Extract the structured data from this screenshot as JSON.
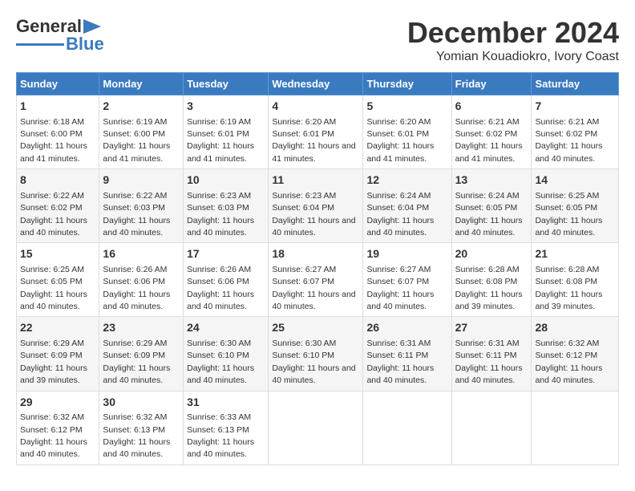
{
  "header": {
    "logo_general": "General",
    "logo_blue": "Blue",
    "title": "December 2024",
    "subtitle": "Yomian Kouadiokro, Ivory Coast"
  },
  "calendar": {
    "days_of_week": [
      "Sunday",
      "Monday",
      "Tuesday",
      "Wednesday",
      "Thursday",
      "Friday",
      "Saturday"
    ],
    "weeks": [
      [
        {
          "day": "1",
          "sunrise": "Sunrise: 6:18 AM",
          "sunset": "Sunset: 6:00 PM",
          "daylight": "Daylight: 11 hours and 41 minutes."
        },
        {
          "day": "2",
          "sunrise": "Sunrise: 6:19 AM",
          "sunset": "Sunset: 6:00 PM",
          "daylight": "Daylight: 11 hours and 41 minutes."
        },
        {
          "day": "3",
          "sunrise": "Sunrise: 6:19 AM",
          "sunset": "Sunset: 6:01 PM",
          "daylight": "Daylight: 11 hours and 41 minutes."
        },
        {
          "day": "4",
          "sunrise": "Sunrise: 6:20 AM",
          "sunset": "Sunset: 6:01 PM",
          "daylight": "Daylight: 11 hours and 41 minutes."
        },
        {
          "day": "5",
          "sunrise": "Sunrise: 6:20 AM",
          "sunset": "Sunset: 6:01 PM",
          "daylight": "Daylight: 11 hours and 41 minutes."
        },
        {
          "day": "6",
          "sunrise": "Sunrise: 6:21 AM",
          "sunset": "Sunset: 6:02 PM",
          "daylight": "Daylight: 11 hours and 41 minutes."
        },
        {
          "day": "7",
          "sunrise": "Sunrise: 6:21 AM",
          "sunset": "Sunset: 6:02 PM",
          "daylight": "Daylight: 11 hours and 40 minutes."
        }
      ],
      [
        {
          "day": "8",
          "sunrise": "Sunrise: 6:22 AM",
          "sunset": "Sunset: 6:02 PM",
          "daylight": "Daylight: 11 hours and 40 minutes."
        },
        {
          "day": "9",
          "sunrise": "Sunrise: 6:22 AM",
          "sunset": "Sunset: 6:03 PM",
          "daylight": "Daylight: 11 hours and 40 minutes."
        },
        {
          "day": "10",
          "sunrise": "Sunrise: 6:23 AM",
          "sunset": "Sunset: 6:03 PM",
          "daylight": "Daylight: 11 hours and 40 minutes."
        },
        {
          "day": "11",
          "sunrise": "Sunrise: 6:23 AM",
          "sunset": "Sunset: 6:04 PM",
          "daylight": "Daylight: 11 hours and 40 minutes."
        },
        {
          "day": "12",
          "sunrise": "Sunrise: 6:24 AM",
          "sunset": "Sunset: 6:04 PM",
          "daylight": "Daylight: 11 hours and 40 minutes."
        },
        {
          "day": "13",
          "sunrise": "Sunrise: 6:24 AM",
          "sunset": "Sunset: 6:05 PM",
          "daylight": "Daylight: 11 hours and 40 minutes."
        },
        {
          "day": "14",
          "sunrise": "Sunrise: 6:25 AM",
          "sunset": "Sunset: 6:05 PM",
          "daylight": "Daylight: 11 hours and 40 minutes."
        }
      ],
      [
        {
          "day": "15",
          "sunrise": "Sunrise: 6:25 AM",
          "sunset": "Sunset: 6:05 PM",
          "daylight": "Daylight: 11 hours and 40 minutes."
        },
        {
          "day": "16",
          "sunrise": "Sunrise: 6:26 AM",
          "sunset": "Sunset: 6:06 PM",
          "daylight": "Daylight: 11 hours and 40 minutes."
        },
        {
          "day": "17",
          "sunrise": "Sunrise: 6:26 AM",
          "sunset": "Sunset: 6:06 PM",
          "daylight": "Daylight: 11 hours and 40 minutes."
        },
        {
          "day": "18",
          "sunrise": "Sunrise: 6:27 AM",
          "sunset": "Sunset: 6:07 PM",
          "daylight": "Daylight: 11 hours and 40 minutes."
        },
        {
          "day": "19",
          "sunrise": "Sunrise: 6:27 AM",
          "sunset": "Sunset: 6:07 PM",
          "daylight": "Daylight: 11 hours and 40 minutes."
        },
        {
          "day": "20",
          "sunrise": "Sunrise: 6:28 AM",
          "sunset": "Sunset: 6:08 PM",
          "daylight": "Daylight: 11 hours and 39 minutes."
        },
        {
          "day": "21",
          "sunrise": "Sunrise: 6:28 AM",
          "sunset": "Sunset: 6:08 PM",
          "daylight": "Daylight: 11 hours and 39 minutes."
        }
      ],
      [
        {
          "day": "22",
          "sunrise": "Sunrise: 6:29 AM",
          "sunset": "Sunset: 6:09 PM",
          "daylight": "Daylight: 11 hours and 39 minutes."
        },
        {
          "day": "23",
          "sunrise": "Sunrise: 6:29 AM",
          "sunset": "Sunset: 6:09 PM",
          "daylight": "Daylight: 11 hours and 40 minutes."
        },
        {
          "day": "24",
          "sunrise": "Sunrise: 6:30 AM",
          "sunset": "Sunset: 6:10 PM",
          "daylight": "Daylight: 11 hours and 40 minutes."
        },
        {
          "day": "25",
          "sunrise": "Sunrise: 6:30 AM",
          "sunset": "Sunset: 6:10 PM",
          "daylight": "Daylight: 11 hours and 40 minutes."
        },
        {
          "day": "26",
          "sunrise": "Sunrise: 6:31 AM",
          "sunset": "Sunset: 6:11 PM",
          "daylight": "Daylight: 11 hours and 40 minutes."
        },
        {
          "day": "27",
          "sunrise": "Sunrise: 6:31 AM",
          "sunset": "Sunset: 6:11 PM",
          "daylight": "Daylight: 11 hours and 40 minutes."
        },
        {
          "day": "28",
          "sunrise": "Sunrise: 6:32 AM",
          "sunset": "Sunset: 6:12 PM",
          "daylight": "Daylight: 11 hours and 40 minutes."
        }
      ],
      [
        {
          "day": "29",
          "sunrise": "Sunrise: 6:32 AM",
          "sunset": "Sunset: 6:12 PM",
          "daylight": "Daylight: 11 hours and 40 minutes."
        },
        {
          "day": "30",
          "sunrise": "Sunrise: 6:32 AM",
          "sunset": "Sunset: 6:13 PM",
          "daylight": "Daylight: 11 hours and 40 minutes."
        },
        {
          "day": "31",
          "sunrise": "Sunrise: 6:33 AM",
          "sunset": "Sunset: 6:13 PM",
          "daylight": "Daylight: 11 hours and 40 minutes."
        },
        {
          "day": "",
          "sunrise": "",
          "sunset": "",
          "daylight": ""
        },
        {
          "day": "",
          "sunrise": "",
          "sunset": "",
          "daylight": ""
        },
        {
          "day": "",
          "sunrise": "",
          "sunset": "",
          "daylight": ""
        },
        {
          "day": "",
          "sunrise": "",
          "sunset": "",
          "daylight": ""
        }
      ]
    ]
  }
}
